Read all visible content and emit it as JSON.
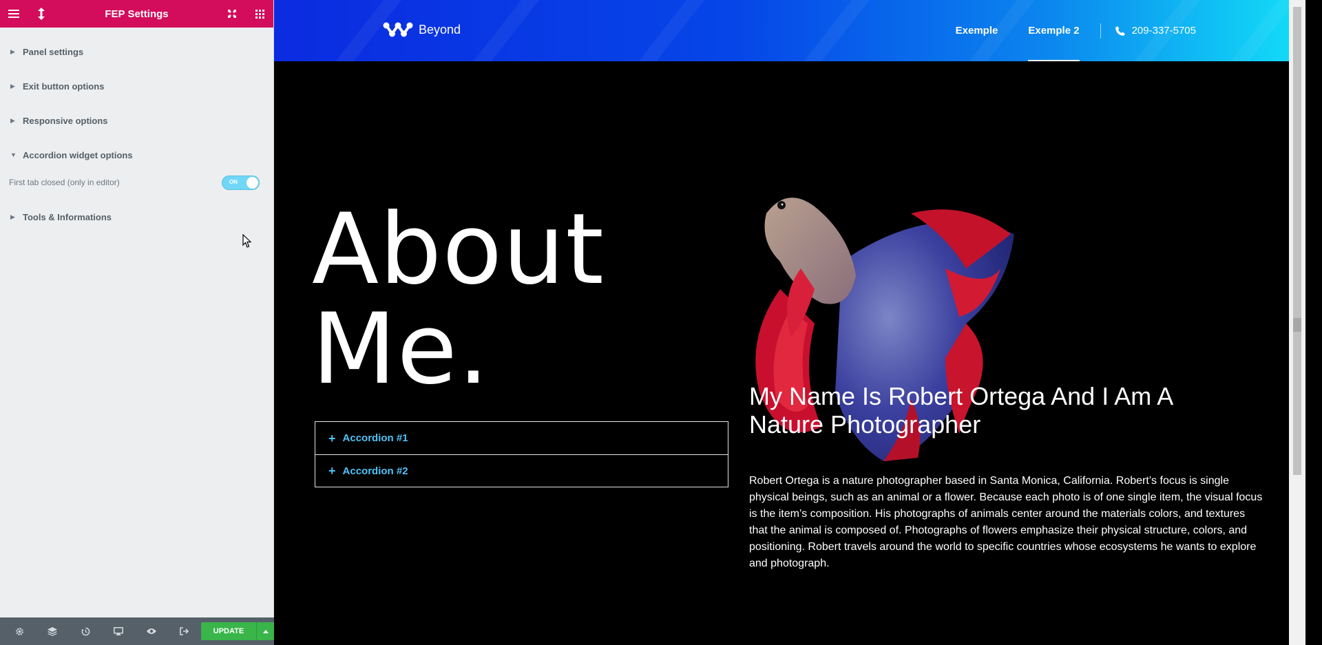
{
  "panel": {
    "title": "FEP Settings",
    "sections": [
      {
        "label": "Panel settings"
      },
      {
        "label": "Exit button options"
      },
      {
        "label": "Responsive options"
      },
      {
        "label": "Accordion widget options"
      },
      {
        "label": "Tools & Informations"
      }
    ],
    "accordion_control": {
      "label": "First tab closed (only in editor)",
      "toggle_text": "ON"
    },
    "footer": {
      "update_label": "UPDATE"
    }
  },
  "site": {
    "logo_text": "Beyond",
    "nav": [
      {
        "label": "Exemple"
      },
      {
        "label": "Exemple 2"
      }
    ],
    "phone": "209-337-5705",
    "about_line1": "About",
    "about_line2": "Me.",
    "accordion": [
      {
        "label": "Accordion #1"
      },
      {
        "label": "Accordion #2"
      }
    ],
    "heading": "My Name Is Robert Ortega And I Am A Nature Photographer",
    "bio": "Robert Ortega is a nature photographer based in Santa Monica, California. Robert’s focus is single physical beings, such as an animal or a flower. Because each photo is of one single item, the visual focus is the item’s composition. His photographs of animals center around the materials colors, and textures that the animal is composed of. Photographs of flowers emphasize their physical structure, colors, and positioning. Robert travels around the world to specific countries whose ecosystems he wants to explore and photograph."
  },
  "colors": {
    "panel_header": "#d30c5c",
    "accent_blue": "#4fc3f7",
    "update_green": "#39b54a"
  }
}
